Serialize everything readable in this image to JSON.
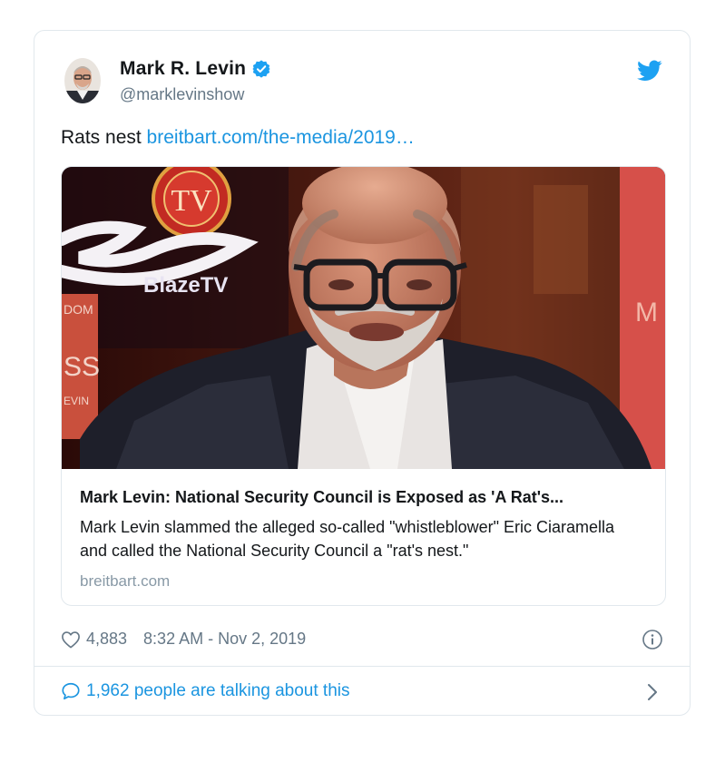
{
  "tweet": {
    "author": {
      "display_name": "Mark R. Levin",
      "handle": "@marklevinshow",
      "verified": true
    },
    "text_prefix": "Rats nest ",
    "link_text": "breitbart.com/the-media/2019…",
    "card": {
      "title": "Mark Levin: National Security Council is Exposed as 'A Rat's...",
      "description": "Mark Levin slammed the alleged so-called \"whistleblower\" Eric Ciaramella and called the National Security Council a \"rat's nest.\"",
      "domain": "breitbart.com",
      "image_overlay": {
        "tv_badge": "TV",
        "brand": "BlazeTV",
        "left_sign_top": "DOM",
        "left_sign_mid": "SS",
        "left_sign_low": "EVIN",
        "right_sign": "M"
      }
    },
    "like_count": "4,883",
    "timestamp": "8:32 AM - Nov 2, 2019",
    "conversation_text": "1,962 people are talking about this"
  },
  "colors": {
    "twitter_blue": "#1da1f2",
    "link_blue": "#1b95e0",
    "secondary_gray": "#657786",
    "border": "#e1e8ed"
  },
  "icons": [
    "verified-badge-icon",
    "twitter-bird-icon",
    "heart-icon",
    "info-icon",
    "speech-bubble-icon",
    "chevron-right-icon"
  ]
}
